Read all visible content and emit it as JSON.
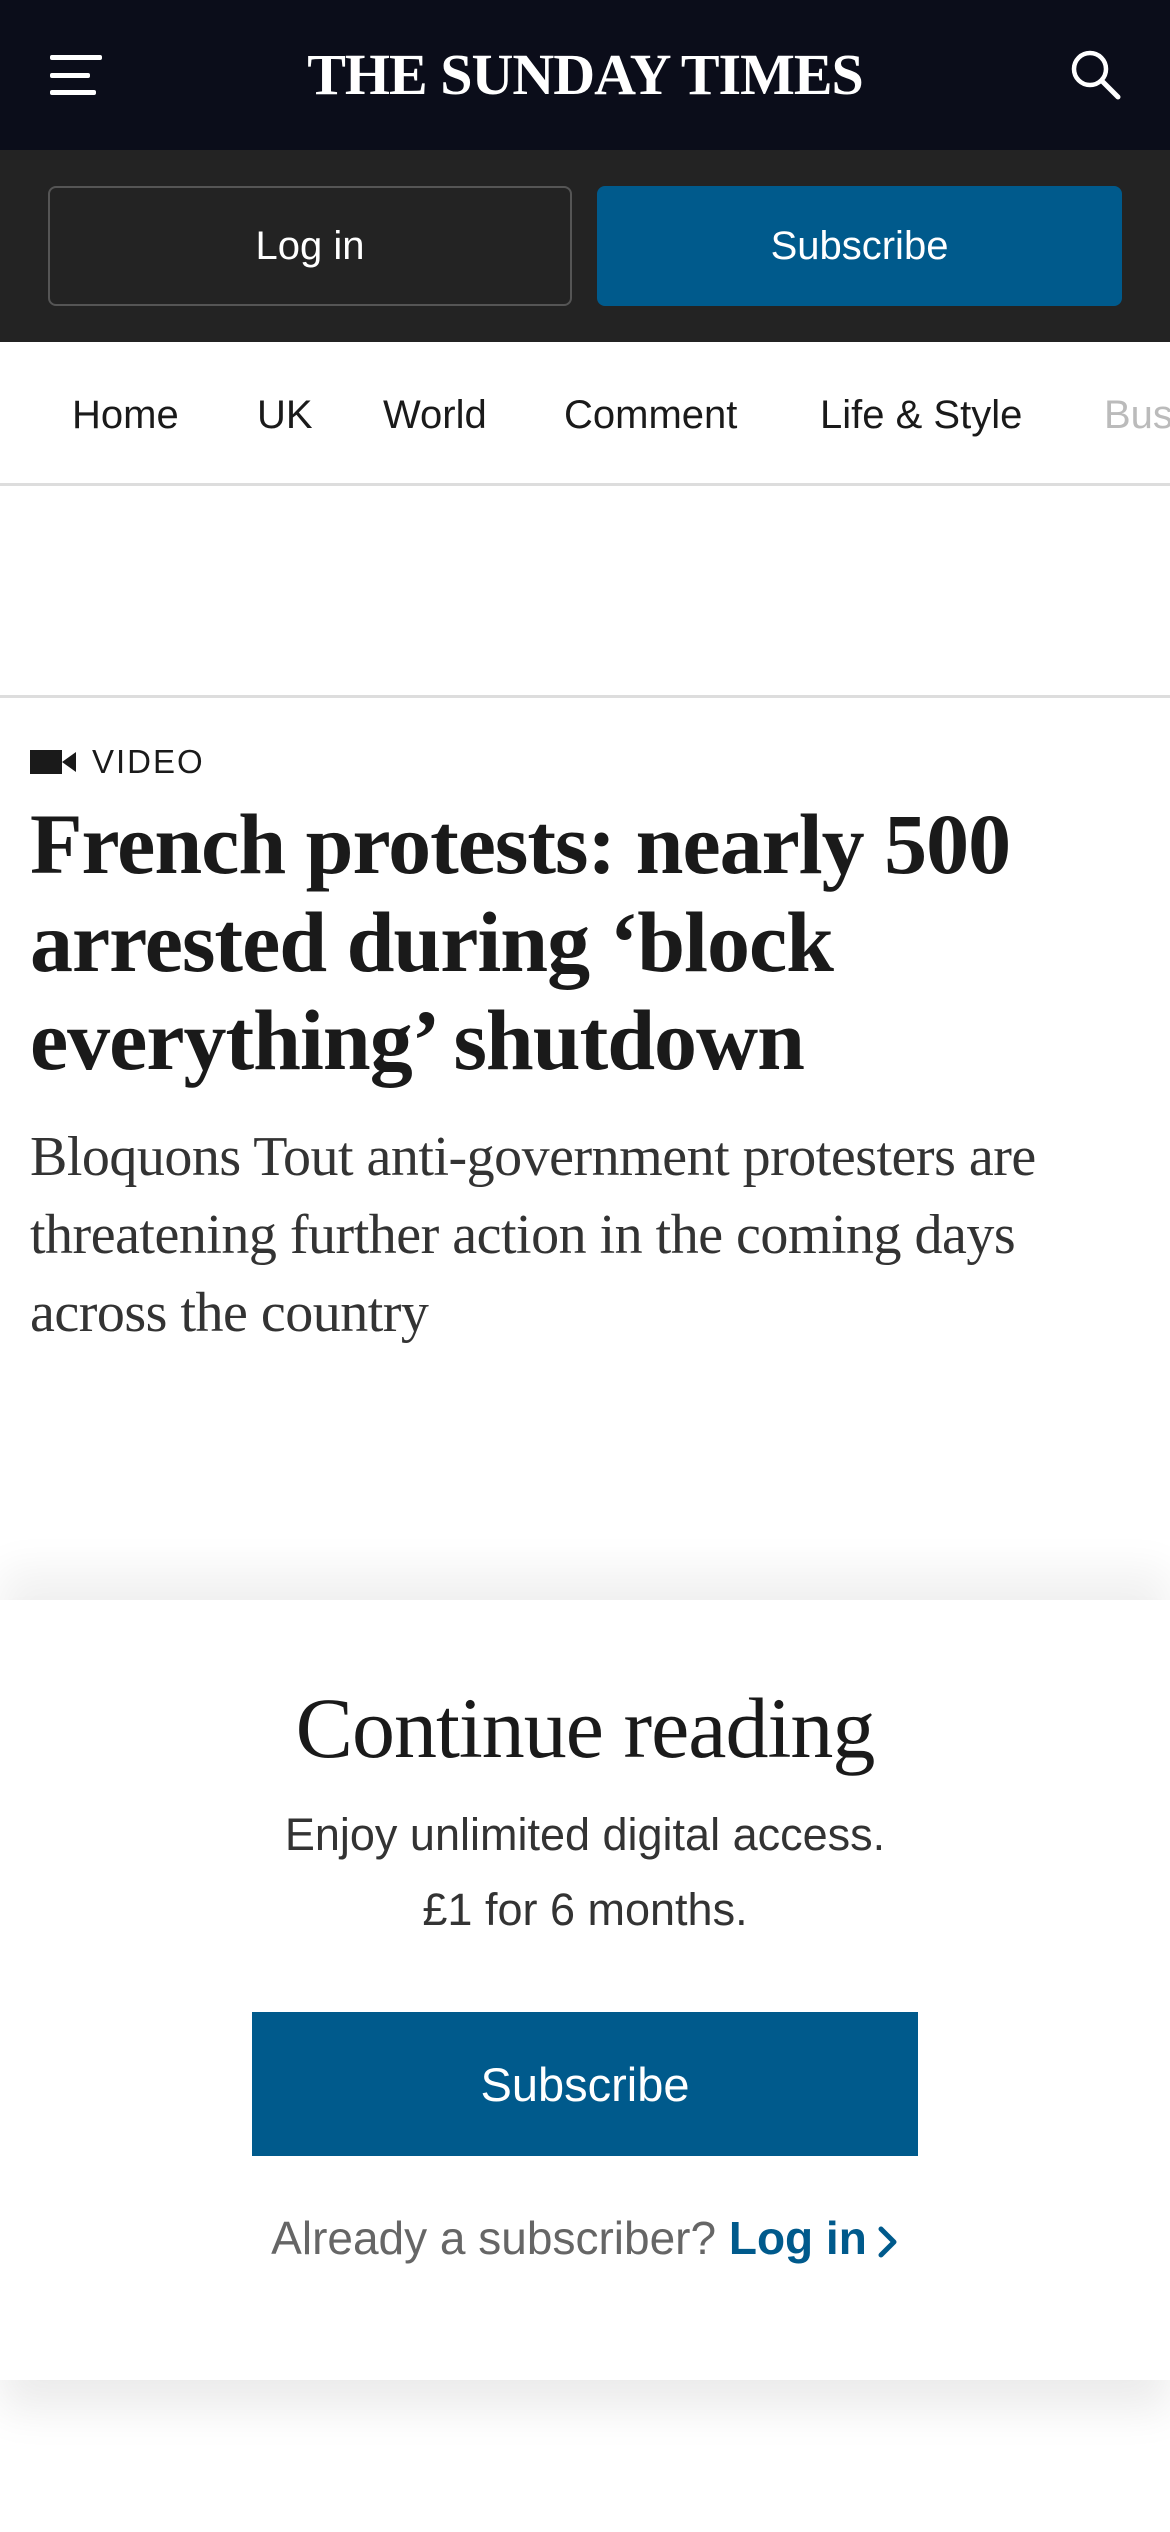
{
  "header": {
    "masthead": "THE SUNDAY TIMES",
    "menu_icon": "hamburger-menu-icon",
    "search_icon": "search-icon"
  },
  "auth": {
    "login_label": "Log in",
    "subscribe_label": "Subscribe"
  },
  "nav": {
    "items": [
      "Home",
      "UK",
      "World",
      "Comment",
      "Life & Style",
      "Bus"
    ]
  },
  "article": {
    "label_icon": "video-camera-icon",
    "label": "VIDEO",
    "headline": "French protests: nearly 500 arrested during ‘block everything’ shutdown",
    "standfirst": "Bloquons Tout anti-government protesters are threatening further action in the coming days across the country"
  },
  "paywall": {
    "title": "Continue reading",
    "line1": "Enjoy unlimited digital access.",
    "line2": "£1 for 6 months.",
    "subscribe_label": "Subscribe",
    "already_text": "Already a subscriber?",
    "login_label": "Log in",
    "login_icon": "chevron-right-icon"
  },
  "colors": {
    "header_bg": "#0b0d1a",
    "auth_bg": "#232323",
    "brand_blue": "#005a8c",
    "text": "#1a1a1a"
  }
}
